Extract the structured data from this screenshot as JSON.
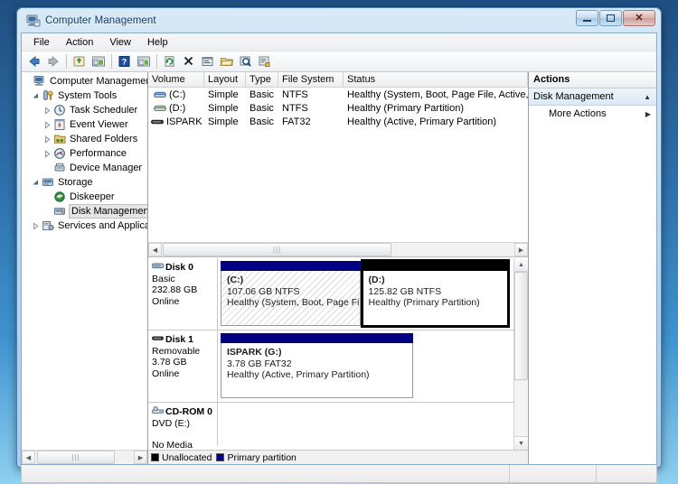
{
  "window": {
    "title": "Computer Management",
    "icon": "computer-management-icon",
    "buttons": {
      "minimize": "–",
      "maximize": "□",
      "close": "✕"
    }
  },
  "menubar": {
    "items": [
      "File",
      "Action",
      "View",
      "Help"
    ]
  },
  "toolbar": {
    "items": [
      {
        "name": "back-icon",
        "glyph": "←"
      },
      {
        "name": "forward-icon",
        "glyph": "→"
      },
      {
        "name": "up-one-level-icon",
        "glyph": "↑"
      },
      {
        "name": "show-hide-console-tree-icon",
        "glyph": "▤"
      },
      {
        "name": "help-icon",
        "glyph": "?"
      },
      {
        "name": "show-hide-action-pane-icon",
        "glyph": "▥"
      },
      {
        "name": "refresh-icon",
        "glyph": "↻"
      },
      {
        "name": "delete-icon",
        "glyph": "✕"
      },
      {
        "name": "properties-icon",
        "glyph": "▣"
      },
      {
        "name": "open-folder-icon",
        "glyph": "▱"
      },
      {
        "name": "search-icon",
        "glyph": "⌕"
      },
      {
        "name": "report-icon",
        "glyph": "▦"
      }
    ]
  },
  "tree": {
    "root": {
      "label": "Computer Management (Local",
      "icon": "computer-icon",
      "expanded": true
    },
    "items": [
      {
        "label": "System Tools",
        "icon": "system-tools-icon",
        "depth": 1,
        "expanded": true,
        "twisty": "open",
        "selected": false
      },
      {
        "label": "Task Scheduler",
        "icon": "clock-icon",
        "depth": 2,
        "expanded": false,
        "twisty": "closed",
        "selected": false
      },
      {
        "label": "Event Viewer",
        "icon": "event-viewer-icon",
        "depth": 2,
        "expanded": false,
        "twisty": "closed",
        "selected": false
      },
      {
        "label": "Shared Folders",
        "icon": "shared-folders-icon",
        "depth": 2,
        "expanded": false,
        "twisty": "closed",
        "selected": false
      },
      {
        "label": "Performance",
        "icon": "performance-icon",
        "depth": 2,
        "expanded": false,
        "twisty": "closed",
        "selected": false
      },
      {
        "label": "Device Manager",
        "icon": "device-manager-icon",
        "depth": 2,
        "expanded": false,
        "twisty": "none",
        "selected": false
      },
      {
        "label": "Storage",
        "icon": "storage-icon",
        "depth": 1,
        "expanded": true,
        "twisty": "open",
        "selected": false
      },
      {
        "label": "Diskeeper",
        "icon": "diskeeper-icon",
        "depth": 2,
        "expanded": false,
        "twisty": "none",
        "selected": false
      },
      {
        "label": "Disk Management",
        "icon": "disk-management-icon",
        "depth": 2,
        "expanded": false,
        "twisty": "none",
        "selected": true
      },
      {
        "label": "Services and Applications",
        "icon": "services-icon",
        "depth": 1,
        "expanded": false,
        "twisty": "closed",
        "selected": false
      }
    ]
  },
  "volume_list": {
    "columns": [
      "Volume",
      "Layout",
      "Type",
      "File System",
      "Status"
    ],
    "rows": [
      {
        "icon": "hard-disk-icon",
        "volume": "(C:)",
        "layout": "Simple",
        "type": "Basic",
        "file_system": "NTFS",
        "status": "Healthy (System, Boot, Page File, Active, Crash Dump, Primary Par"
      },
      {
        "icon": "hard-disk-icon-gray",
        "volume": "(D:)",
        "layout": "Simple",
        "type": "Basic",
        "file_system": "NTFS",
        "status": "Healthy (Primary Partition)"
      },
      {
        "icon": "removable-disk-icon",
        "volume": "ISPARK (G:)",
        "layout": "Simple",
        "type": "Basic",
        "file_system": "FAT32",
        "status": "Healthy (Active, Primary Partition)"
      }
    ]
  },
  "disk_view": {
    "disks": [
      {
        "name": "Disk 0",
        "icon": "disk-icon",
        "type": "Basic",
        "size": "232.88 GB",
        "state": "Online",
        "partitions": [
          {
            "name": "(C:)",
            "size_fs": "107.06 GB NTFS",
            "status": "Healthy (System, Boot, Page File, Active, ",
            "style": "hatched",
            "bar": "blue",
            "selected": false,
            "width_pct": 48
          },
          {
            "name": "(D:)",
            "size_fs": "125.82 GB NTFS",
            "status": "Healthy (Primary Partition)",
            "style": "plain",
            "bar": "black",
            "selected": true,
            "width_pct": 52
          }
        ]
      },
      {
        "name": "Disk 1",
        "icon": "removable-icon",
        "type": "Removable",
        "size": "3.78 GB",
        "state": "Online",
        "partitions": [
          {
            "name": "ISPARK  (G:)",
            "size_fs": "3.78 GB FAT32",
            "status": "Healthy (Active, Primary Partition)",
            "style": "plain",
            "bar": "blue",
            "selected": false,
            "width_pct": 67
          }
        ]
      },
      {
        "name": "CD-ROM 0",
        "icon": "cdrom-icon",
        "type": "DVD (E:)",
        "size": "",
        "state": "No Media",
        "partitions": []
      }
    ]
  },
  "legend": {
    "items": [
      {
        "label": "Unallocated",
        "color": "#000000"
      },
      {
        "label": "Primary partition",
        "color": "#000080"
      }
    ]
  },
  "actions": {
    "title": "Actions",
    "group": {
      "label": "Disk Management",
      "collapse_icon": "chevron-up-icon"
    },
    "items": [
      {
        "label": "More Actions",
        "submenu_icon": "chevron-right-icon"
      }
    ]
  },
  "statusbar": {
    "main": "",
    "seg2": "",
    "seg3": ""
  }
}
